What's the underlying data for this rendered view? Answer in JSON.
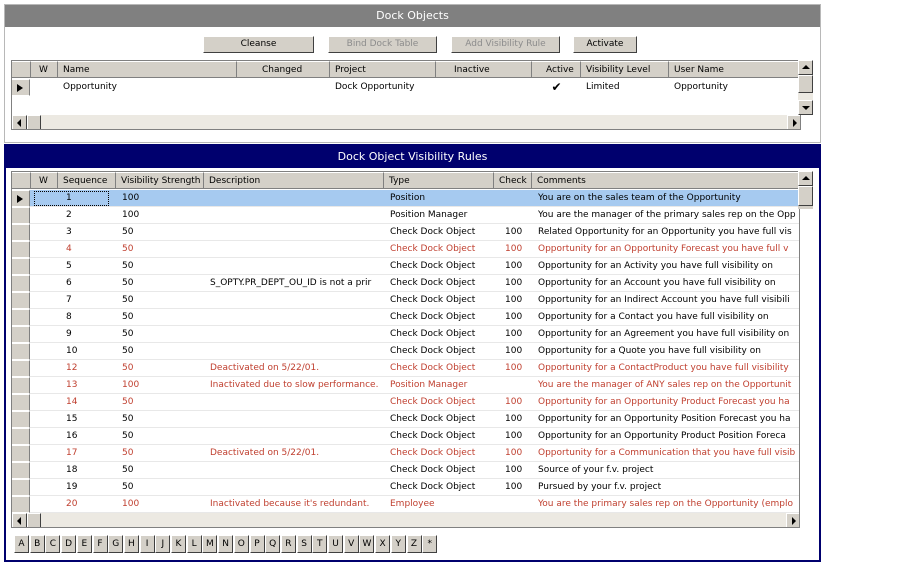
{
  "top_applet": {
    "title": "Dock Objects",
    "buttons": [
      {
        "label": "Cleanse",
        "enabled": true
      },
      {
        "label": "Bind Dock Table",
        "enabled": false
      },
      {
        "label": "Add Visibility Rule",
        "enabled": false
      },
      {
        "label": "Activate",
        "enabled": true
      }
    ],
    "columns": [
      "W",
      "Name",
      "Changed",
      "Project",
      "Inactive",
      "Active",
      "Visibility Level",
      "User Name"
    ],
    "rows": [
      {
        "w": "",
        "name": "Opportunity",
        "changed": "",
        "project": "Dock Opportunity",
        "inactive": "",
        "active": "✔",
        "visibility_level": "Limited",
        "user_name": "Opportunity"
      }
    ]
  },
  "bottom_applet": {
    "title": "Dock Object Visibility Rules",
    "columns": [
      "W",
      "Sequence",
      "Visibility Strength",
      "Description",
      "Type",
      "Check",
      "Comments"
    ],
    "rows": [
      {
        "seq": "1",
        "strength": "100",
        "desc": "",
        "type": "Position",
        "check": "",
        "comments": "You are on the sales team of the Opportunity",
        "inactive": false,
        "selected": true
      },
      {
        "seq": "2",
        "strength": "100",
        "desc": "",
        "type": "Position Manager",
        "check": "",
        "comments": "You are the manager of the primary sales rep on the Opp",
        "inactive": false
      },
      {
        "seq": "3",
        "strength": "50",
        "desc": "",
        "type": "Check Dock Object",
        "check": "100",
        "comments": "Related Opportunity for an Opportunity you have full vis",
        "inactive": false
      },
      {
        "seq": "4",
        "strength": "50",
        "desc": "",
        "type": "Check Dock Object",
        "check": "100",
        "comments": "Opportunity for an Opportunity Forecast you have full v",
        "inactive": true
      },
      {
        "seq": "5",
        "strength": "50",
        "desc": "",
        "type": "Check Dock Object",
        "check": "100",
        "comments": "Opportunity for an Activity you have full visibility on",
        "inactive": false
      },
      {
        "seq": "6",
        "strength": "50",
        "desc": "S_OPTY.PR_DEPT_OU_ID is not a prir",
        "type": "Check Dock Object",
        "check": "100",
        "comments": "Opportunity for an Account you have full visibility on",
        "inactive": false
      },
      {
        "seq": "7",
        "strength": "50",
        "desc": "",
        "type": "Check Dock Object",
        "check": "100",
        "comments": "Opportunity for an Indirect Account you have full visibili",
        "inactive": false
      },
      {
        "seq": "8",
        "strength": "50",
        "desc": "",
        "type": "Check Dock Object",
        "check": "100",
        "comments": "Opportunity for a Contact you have full visibility on",
        "inactive": false
      },
      {
        "seq": "9",
        "strength": "50",
        "desc": "",
        "type": "Check Dock Object",
        "check": "100",
        "comments": "Opportunity for an Agreement you have full visibility on",
        "inactive": false
      },
      {
        "seq": "10",
        "strength": "50",
        "desc": "",
        "type": "Check Dock Object",
        "check": "100",
        "comments": "Opportunity for a Quote you have full visibility on",
        "inactive": false
      },
      {
        "seq": "12",
        "strength": "50",
        "desc": "Deactivated on 5/22/01.",
        "type": "Check Dock Object",
        "check": "100",
        "comments": "Opportunity for a ContactProduct you have full visibility",
        "inactive": true
      },
      {
        "seq": "13",
        "strength": "100",
        "desc": "Inactivated due to slow performance.",
        "type": "Position Manager",
        "check": "",
        "comments": "You are the manager of ANY sales rep on the Opportunit",
        "inactive": true
      },
      {
        "seq": "14",
        "strength": "50",
        "desc": "",
        "type": "Check Dock Object",
        "check": "100",
        "comments": "Opportunity for an Opportunity Product Forecast you ha",
        "inactive": true
      },
      {
        "seq": "15",
        "strength": "50",
        "desc": "",
        "type": "Check Dock Object",
        "check": "100",
        "comments": "Opportunity for an Opportunity Position Forecast you ha",
        "inactive": false
      },
      {
        "seq": "16",
        "strength": "50",
        "desc": "",
        "type": "Check Dock Object",
        "check": "100",
        "comments": "Opportunity for an Opportunity Product Position Foreca",
        "inactive": false
      },
      {
        "seq": "17",
        "strength": "50",
        "desc": "Deactivated on 5/22/01.",
        "type": "Check Dock Object",
        "check": "100",
        "comments": "Opportunity for a Communication that you have full visib",
        "inactive": true
      },
      {
        "seq": "18",
        "strength": "50",
        "desc": "",
        "type": "Check Dock Object",
        "check": "100",
        "comments": "Source of your f.v. project",
        "inactive": false
      },
      {
        "seq": "19",
        "strength": "50",
        "desc": "",
        "type": "Check Dock Object",
        "check": "100",
        "comments": "Pursued by your f.v. project",
        "inactive": false
      },
      {
        "seq": "20",
        "strength": "100",
        "desc": "Inactivated because it's redundant.",
        "type": "Employee",
        "check": "",
        "comments": "You are the primary sales rep on the Opportunity (emplo",
        "inactive": true
      }
    ],
    "alphabet": [
      "A",
      "B",
      "C",
      "D",
      "E",
      "F",
      "G",
      "H",
      "I",
      "J",
      "K",
      "L",
      "M",
      "N",
      "O",
      "P",
      "Q",
      "R",
      "S",
      "T",
      "U",
      "V",
      "W",
      "X",
      "Y",
      "Z",
      "*"
    ]
  },
  "colors": {
    "title_gray": "#808080",
    "title_blue": "#00006e",
    "inactive_text": "#c04030",
    "selected_row": "#a6caf0"
  }
}
